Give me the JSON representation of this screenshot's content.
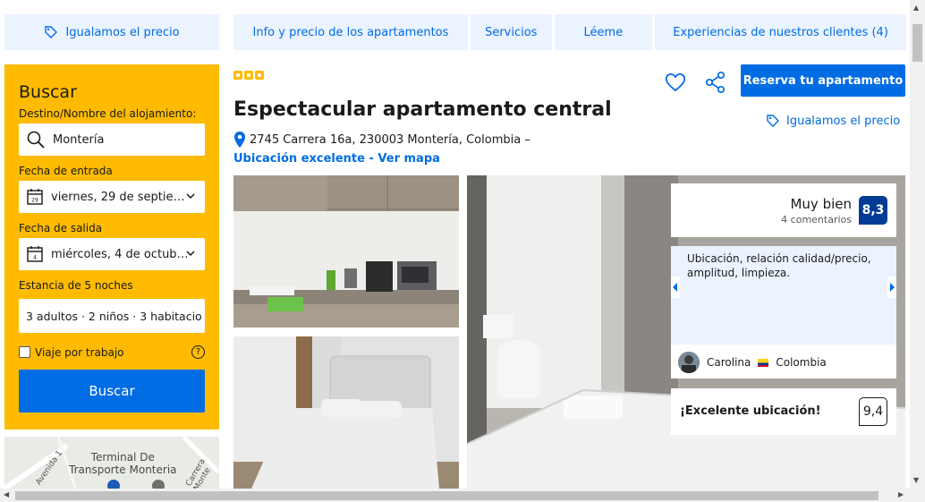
{
  "top": {
    "price_match": "Igualamos el precio",
    "tabs": [
      {
        "label": "Info y precio de los apartamentos"
      },
      {
        "label": "Servicios"
      },
      {
        "label": "Léeme"
      },
      {
        "label": "Experiencias de nuestros clientes (4)"
      }
    ]
  },
  "search": {
    "title": "Buscar",
    "destination_label": "Destino/Nombre del alojamiento:",
    "destination_value": "Montería",
    "checkin_label": "Fecha de entrada",
    "checkin_value": "viernes, 29 de septie…",
    "checkin_day": "29",
    "checkout_label": "Fecha de salida",
    "checkout_value": "miércoles, 4 de octub…",
    "checkout_day": "4",
    "stay_label": "Estancia de 5 noches",
    "guests_value": "3 adultos · 2 niños · 3 habitacio",
    "work_trip_label": "Viaje por trabajo",
    "help": "?",
    "button": "Buscar"
  },
  "map": {
    "label_line1": "Terminal De",
    "label_line2": "Transporte Monteria",
    "road1": "Avenida 1",
    "road2": "Carrera Monte"
  },
  "property": {
    "title": "Espectacular apartamento central",
    "address": "2745 Carrera 16a, 230003 Montería, Colombia –",
    "location_link": "Ubicación excelente - Ver mapa",
    "reserve_button": "Reserva tu apartamento",
    "price_match": "Igualamos el precio",
    "stars": 3
  },
  "reviews": {
    "score_label": "Muy bien",
    "score_count": "4 comentarios",
    "score": "8,3",
    "quote": "Ubicación, relación calidad/precio, amplitud, limpieza.",
    "reviewer_name": "Carolina",
    "reviewer_country": "Colombia",
    "category_label": "¡Excelente ubicación!",
    "category_score": "9,4"
  },
  "colors": {
    "brand_blue": "#006ce4",
    "dark_blue": "#003b95",
    "yellow": "#febb02",
    "light_blue": "#ebf3ff"
  }
}
